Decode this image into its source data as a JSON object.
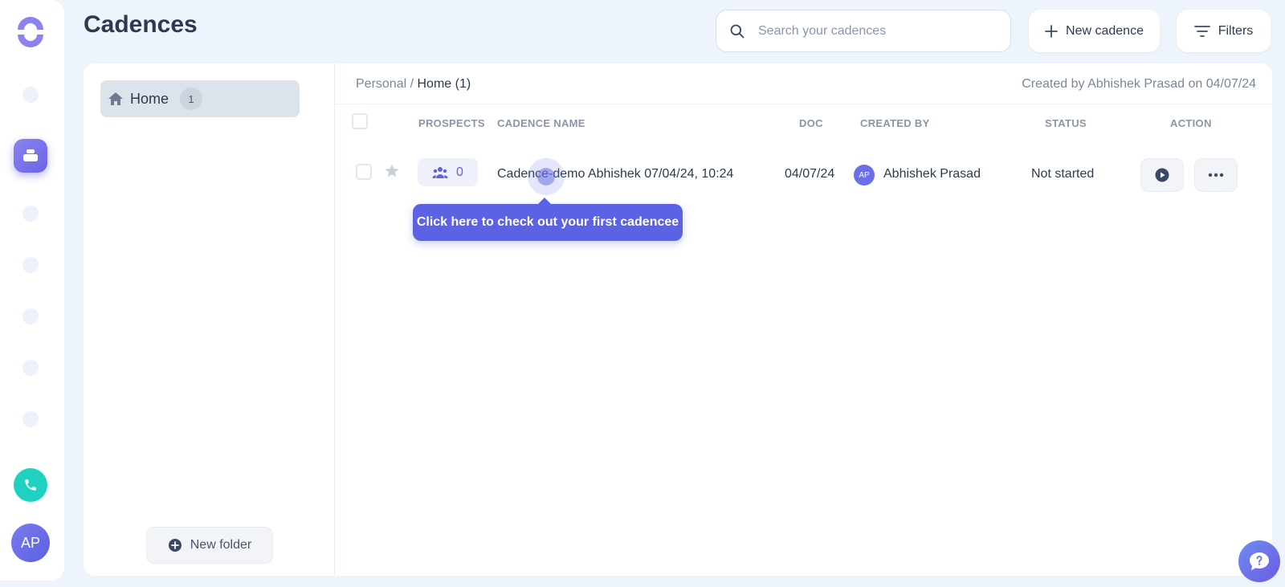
{
  "page": {
    "title": "Cadences"
  },
  "colors": {
    "accent": "#5b62e3",
    "phone": "#1fd1c1",
    "background": "#eef4fb"
  },
  "rail": {
    "avatar_initials": "AP",
    "icons": [
      "logo-icon",
      "cadence-icon",
      "phone-icon"
    ]
  },
  "search": {
    "placeholder": "Search your cadences"
  },
  "toolbar": {
    "new_cadence_label": "New cadence",
    "filters_label": "Filters"
  },
  "folders": {
    "home": {
      "label": "Home",
      "count": "1"
    },
    "new_folder_label": "New folder"
  },
  "breadcrumb": {
    "parent": "Personal /",
    "current": "Home (1)"
  },
  "created_info": "Created by Abhishek Prasad on 04/07/24",
  "table": {
    "columns": [
      "PROSPECTS",
      "CADENCE NAME",
      "DOC",
      "CREATED BY",
      "STATUS",
      "ACTION"
    ],
    "rows": [
      {
        "prospects": "0",
        "name": "Cadence-demo Abhishek 07/04/24, 10:24",
        "doc": "04/07/24",
        "creator_initials": "AP",
        "creator": "Abhishek Prasad",
        "status": "Not started"
      }
    ]
  },
  "tooltip": {
    "text": "Click here to check out your first cadencee"
  }
}
